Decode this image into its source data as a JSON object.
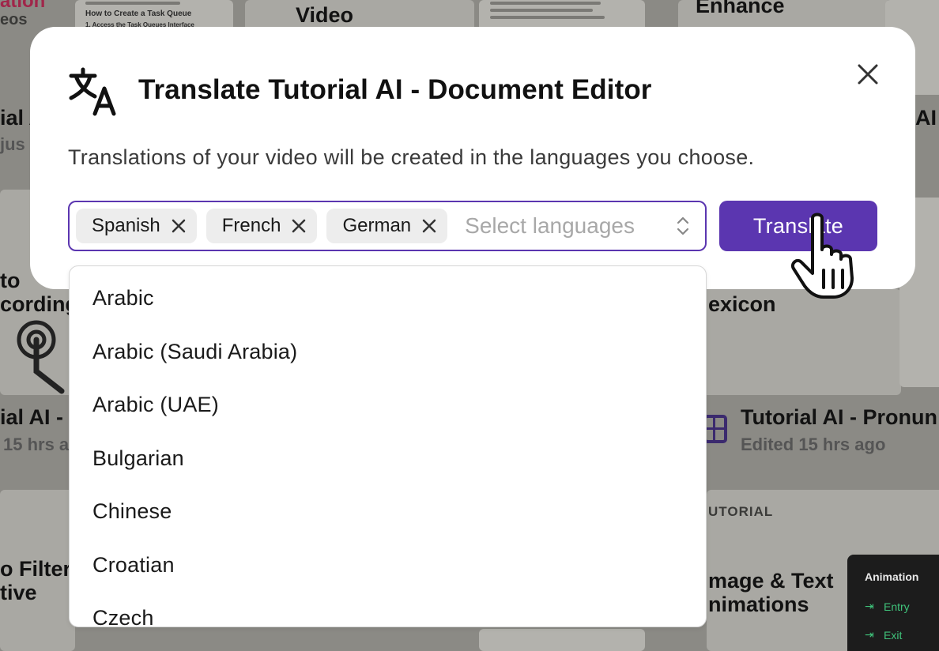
{
  "background": {
    "items": [
      {
        "id": "t1",
        "text": "ation"
      },
      {
        "id": "t2",
        "text": "eos"
      },
      {
        "id": "t3",
        "text": "How to Create a Task Queue"
      },
      {
        "id": "t4",
        "text": "1. Access the Task Queues Interface"
      },
      {
        "id": "t5",
        "text": "Video"
      },
      {
        "id": "t6",
        "text": "Enhance"
      },
      {
        "id": "t7",
        "text": "ial A"
      },
      {
        "id": "t8",
        "text": "jus"
      },
      {
        "id": "t9",
        "text": "AI T"
      },
      {
        "id": "t10",
        "text": "to"
      },
      {
        "id": "t11",
        "text": "cording"
      },
      {
        "id": "t12",
        "text": "exicon"
      },
      {
        "id": "t13",
        "text": "ial AI -"
      },
      {
        "id": "t14",
        "text": "15 hrs a"
      },
      {
        "id": "t15",
        "text": "Tutorial AI - Pronun"
      },
      {
        "id": "t16",
        "text": "Edited 15 hrs ago"
      },
      {
        "id": "t17",
        "text": "UTORIAL"
      },
      {
        "id": "t18",
        "text": "o Filter"
      },
      {
        "id": "t19",
        "text": "tive"
      },
      {
        "id": "t20",
        "text": "mage & Text"
      },
      {
        "id": "t21",
        "text": "nimations"
      }
    ],
    "animation_panel": {
      "title": "Animation",
      "entry": "Entry",
      "exit": "Exit"
    }
  },
  "modal": {
    "title": "Translate Tutorial AI - Document Editor",
    "description": "Translations of your video will be created in the languages you choose.",
    "selected_languages": [
      "Spanish",
      "French",
      "German"
    ],
    "placeholder": "Select languages",
    "translate_label": "Translate"
  },
  "dropdown": {
    "options": [
      "Arabic",
      "Arabic (Saudi Arabia)",
      "Arabic (UAE)",
      "Bulgarian",
      "Chinese",
      "Croatian",
      "Czech"
    ]
  },
  "colors": {
    "accent": "#5b36b0",
    "chip_bg": "#ededed",
    "overlay_bg": "#8b8a85"
  }
}
